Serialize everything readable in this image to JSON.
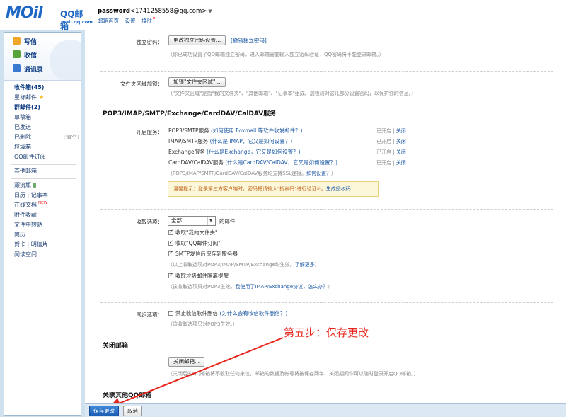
{
  "header": {
    "logo_mail": "MOil",
    "logo_qq": "QQ邮箱",
    "logo_domain": "mail.qq.com",
    "account_label": "password",
    "account_email": "<1741258558@qq.com>",
    "caret": "▼",
    "links": [
      "邮箱首页",
      "设置",
      "换肤"
    ]
  },
  "sidebar": {
    "quick": [
      "写信",
      "收信",
      "通讯录"
    ],
    "folders": {
      "inbox": "收件箱(45)",
      "starred": "星标邮件",
      "group": "群邮件(2)",
      "drafts": "草稿箱",
      "sent": "已发送",
      "deleted": "已删除",
      "deleted_clear": "[清空]",
      "spam": "垃圾箱",
      "subscribe": "QQ邮件订阅",
      "other": "其他邮箱",
      "bottle": "漂流瓶",
      "calendar": "日历",
      "notes": "记事本",
      "docs": "在线文档",
      "docs_badge": "NEW",
      "attach": "附件收藏",
      "transfer": "文件中转站",
      "resume": "简历",
      "cards": "贺卡",
      "postcard": "明信片",
      "reading": "阅读空间"
    }
  },
  "main": {
    "indep_pwd_label": "独立密码：",
    "indep_pwd_btn": "更改独立密码设置...",
    "indep_pwd_revoke": "[撤销独立密码]",
    "indep_pwd_hint": "（你已成功设置了QQ邮箱独立密码。进入邮箱需要输入独立密码验证，QQ密码将不能登录邮箱。）",
    "folder_lock_label": "文件夹区域加锁：",
    "folder_lock_btn": "加锁\"文件夹区域\"...",
    "folder_lock_hint": "（\"文件夹区域\"是指\"我的文件夹\"、\"其他邮箱\"、\"记事本\"组成。加锁则对这几部分设置密码，以保护你的信息。）",
    "section_pop": "POP3/IMAP/SMTP/Exchange/CardDAV/CalDAV服务",
    "enable_label": "开启服务：",
    "services": [
      {
        "name": "POP3/SMTP服务",
        "help": "(如何使用 Foxmail 等软件收发邮件？)",
        "status": "已开启",
        "action": "关闭"
      },
      {
        "name": "IMAP/SMTP服务",
        "help": "(什么是 IMAP，它又是如何设置？)",
        "status": "已开启",
        "action": "关闭"
      },
      {
        "name": "Exchange服务",
        "help": "(什么是Exchange，它又是如何设置？)",
        "status": "已开启",
        "action": "关闭"
      },
      {
        "name": "CardDAV/CalDAV服务",
        "help": "(什么是CardDAV/CalDAV，它又是如何设置？)",
        "status": "已开启",
        "action": "关闭"
      }
    ],
    "ssl_hint": "（POP3/IMAP/SMTP/CardDAV/CalDAV服务均支持SSL连接。",
    "ssl_link": "如何设置？",
    "ssl_end": "）",
    "warn_text": "温馨提示：登录第三方客户端时，密码框请输入\"授权码\"进行验证⑦。",
    "warn_link": "生成授权码",
    "receive_label": "收取选项：",
    "receive_select": "全部",
    "receive_suffix": "的邮件",
    "receive_opts": [
      {
        "label": "收取\"我的文件夹\"",
        "checked": true
      },
      {
        "label": "收取\"QQ邮件订阅\"",
        "checked": true
      },
      {
        "label": "SMTP发信后保存到服务器",
        "checked": true
      }
    ],
    "receive_hint1": "（以上收取选项对POP3/IMAP/SMTP/Exchange均生效。",
    "receive_hint1_link": "了解更多",
    "receive_hint1_end": "）",
    "receive_spam": "收取垃圾邮件隔离提醒",
    "receive_hint2": "（该收取选项只对POP3生效。",
    "receive_hint2_link": "我使用了IMAP/Exchange协议，怎么办？",
    "receive_hint2_end": "）",
    "sync_label": "同步选项：",
    "sync_opt": "禁止收信软件删信",
    "sync_help": "(为什么会有收信软件删信？)",
    "sync_hint": "（该收取选项只对POP3生效。）",
    "section_close": "关闭邮箱",
    "close_btn": "关闭邮箱...",
    "close_hint": "（关闭后的QQ邮箱将不收取任何来信，邮箱的数据及帐号将被保存两年，关闭期间你可以随时登录开启QQ邮箱。）",
    "section_assoc": "关联其他QQ邮箱"
  },
  "annotation": "第五步：保存更改",
  "bottom": {
    "save": "保存更改",
    "cancel": "取消"
  }
}
